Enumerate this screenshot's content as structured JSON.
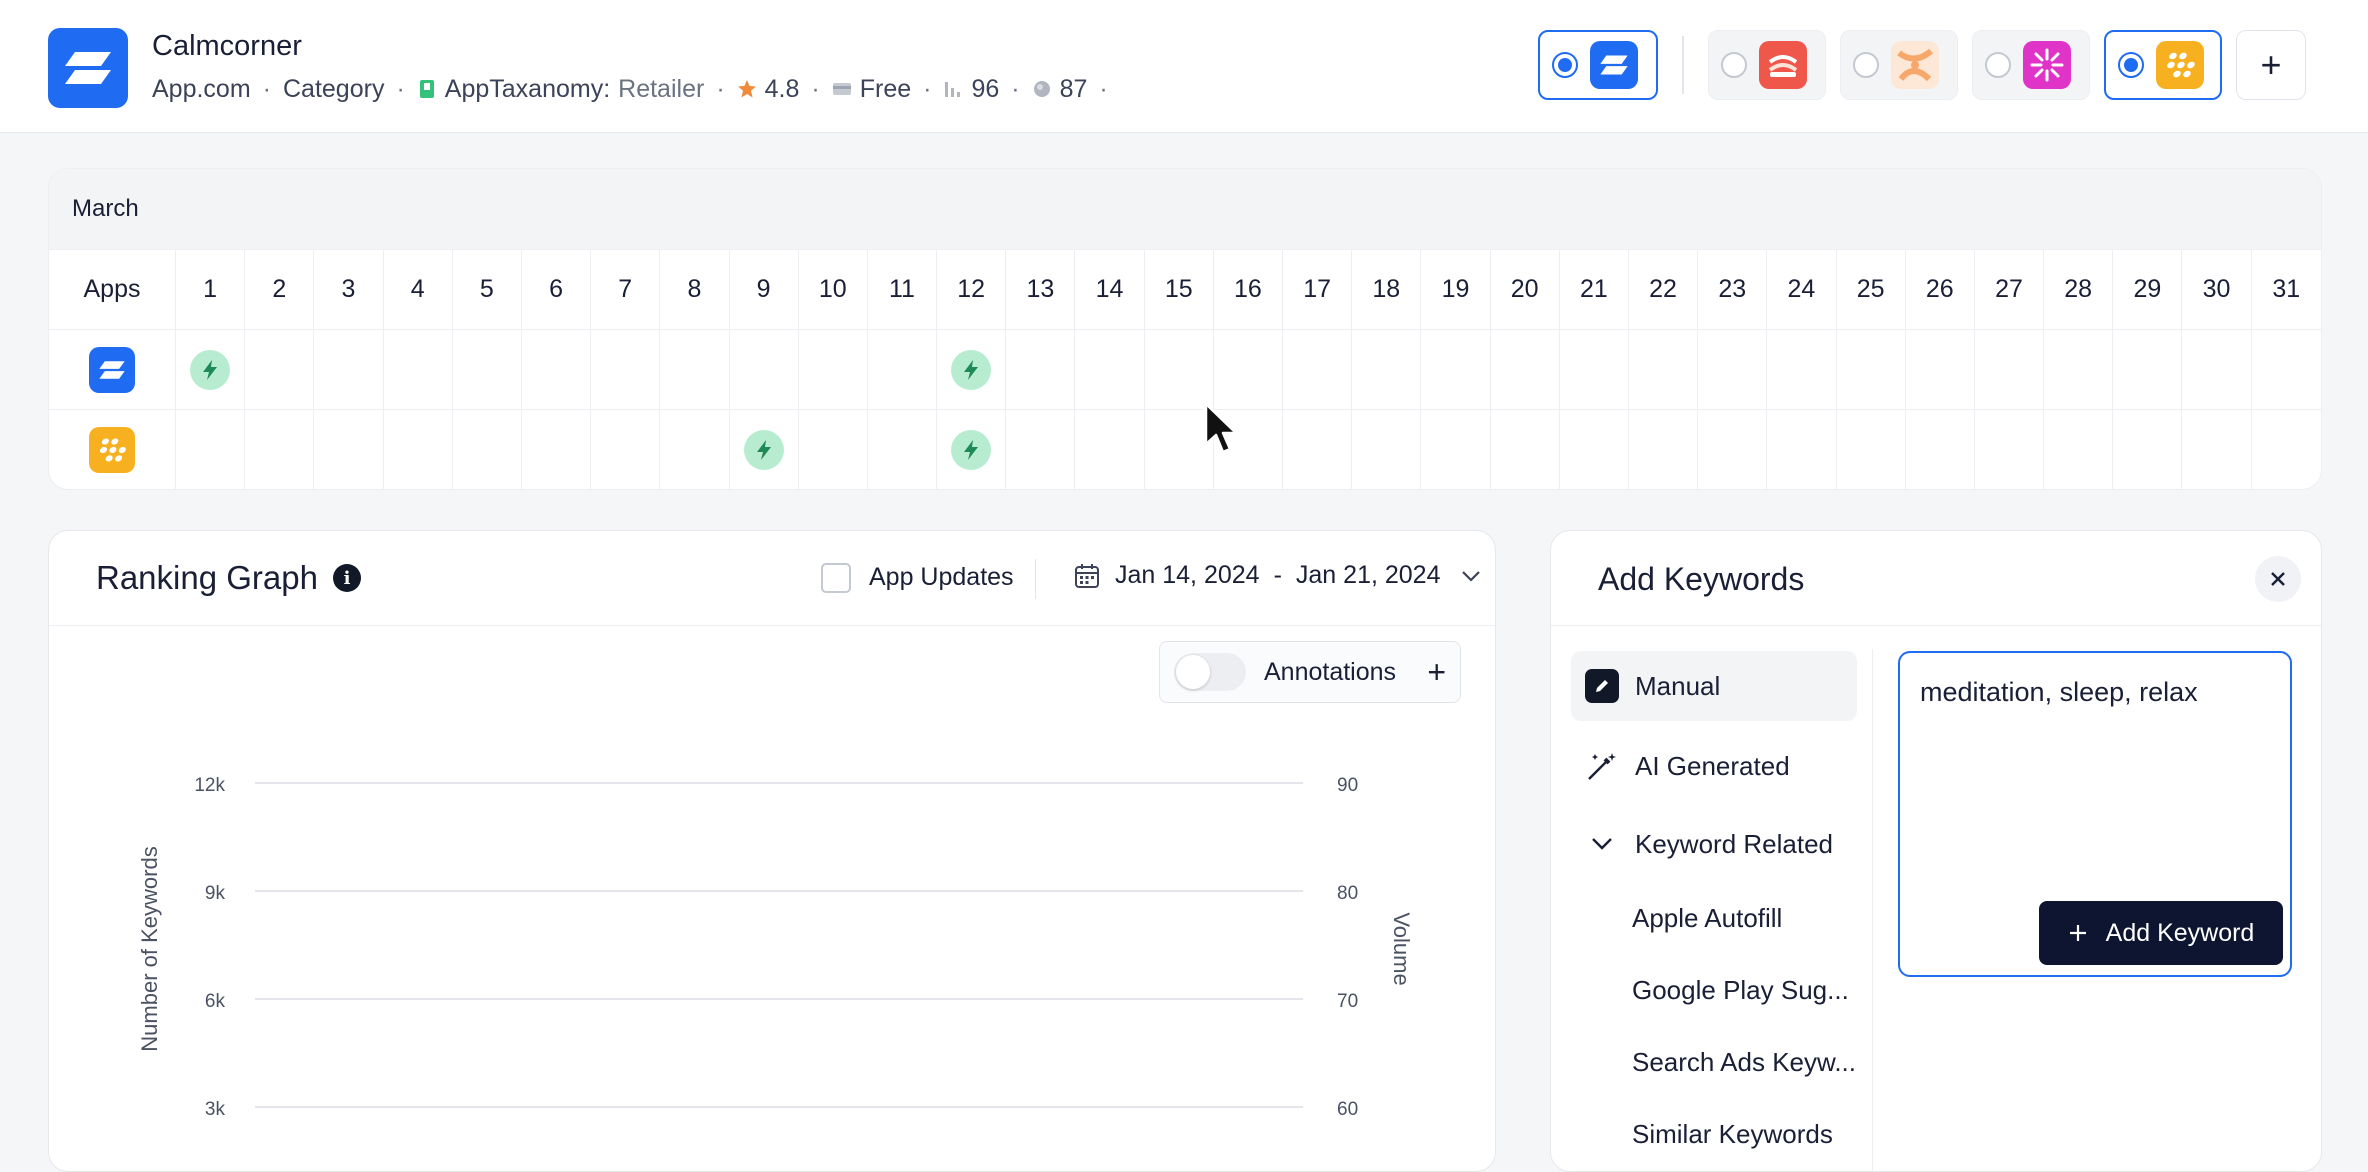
{
  "app": {
    "name": "Calmcorner",
    "developer": "App.com",
    "category": "Category",
    "taxonomy_label": "AppTaxanomy:",
    "taxonomy_value": "Retailer",
    "rating": "4.8",
    "price": "Free",
    "rank_score": "96",
    "visibility_score": "87",
    "brand_color": "#1f6bf2"
  },
  "compare_apps": [
    {
      "icon": "calmcorner-app-icon",
      "color": "#1f6bf2",
      "selected": true
    },
    {
      "icon": "sushi-app-icon",
      "color": "#f0574b",
      "selected": false
    },
    {
      "icon": "orange-pattern-app-icon",
      "color": "#f7a76a",
      "selected": false
    },
    {
      "icon": "pink-burst-app-icon",
      "color": "#e034c8",
      "selected": false
    },
    {
      "icon": "dots-app-icon",
      "color": "#f7b020",
      "selected": true
    }
  ],
  "calendar": {
    "month": "March",
    "apps_header": "Apps",
    "days": [
      "1",
      "2",
      "3",
      "4",
      "5",
      "6",
      "7",
      "8",
      "9",
      "10",
      "11",
      "12",
      "13",
      "14",
      "15",
      "16",
      "17",
      "18",
      "19",
      "20",
      "21",
      "22",
      "23",
      "24",
      "25",
      "26",
      "27",
      "28",
      "29",
      "30",
      "31"
    ],
    "rows": [
      {
        "app_icon": "calmcorner-app-icon",
        "update_days": [
          "1",
          "12"
        ]
      },
      {
        "app_icon": "dots-app-icon",
        "update_days": [
          "9",
          "12"
        ]
      }
    ],
    "update_marker_color": "#b7ecd0"
  },
  "ranking_graph": {
    "title": "Ranking Graph",
    "app_updates_label": "App Updates",
    "app_updates_checked": false,
    "date_start": "Jan 14, 2024",
    "date_sep": "-",
    "date_end": "Jan 21, 2024",
    "annotations_label": "Annotations",
    "annotations_on": false
  },
  "chart_data": {
    "type": "line",
    "title": "",
    "ylabel": "Number of Keywords",
    "y2label": "Volume",
    "yticks": [
      "12k",
      "9k",
      "6k",
      "3k"
    ],
    "y2ticks": [
      "90",
      "80",
      "70",
      "60"
    ],
    "ylim": [
      3000,
      12000
    ],
    "y2lim": [
      60,
      90
    ],
    "series": [],
    "grid": true
  },
  "add_keywords": {
    "title": "Add Keywords",
    "menu": [
      {
        "label": "Manual",
        "icon": "pencil-icon",
        "active": true
      },
      {
        "label": "AI Generated",
        "icon": "magic-wand-icon",
        "active": false
      },
      {
        "label": "Keyword Related",
        "icon": "chevron-down-icon",
        "active": false
      }
    ],
    "sub_menu": [
      "Apple Autofill",
      "Google Play Sug...",
      "Search Ads Keyw...",
      "Similar Keywords"
    ],
    "input_value": "meditation, sleep, relax",
    "add_button_label": "Add Keyword"
  }
}
